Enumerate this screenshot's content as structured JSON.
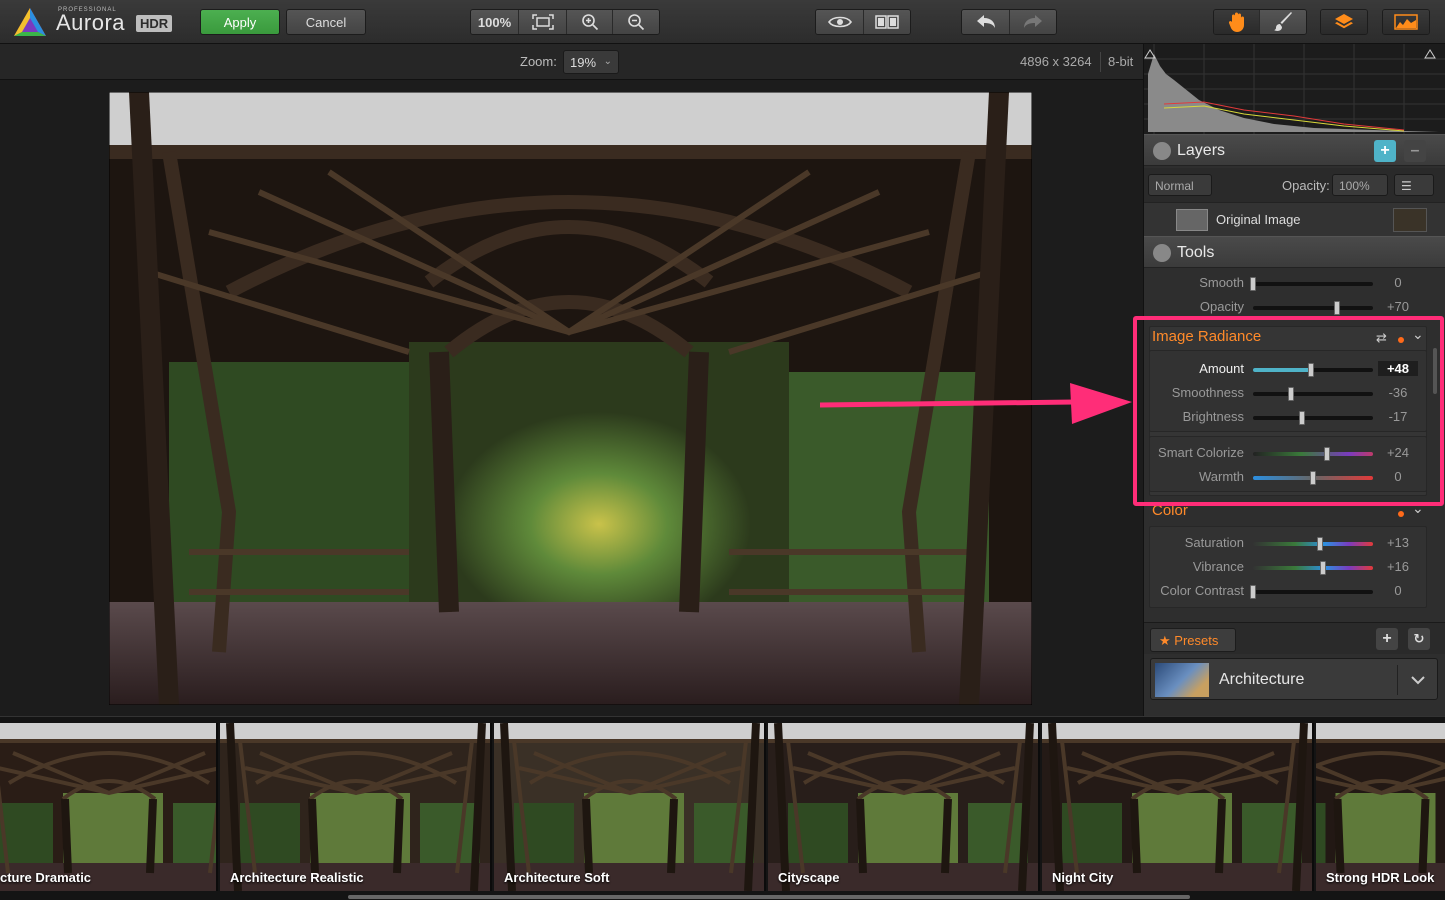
{
  "app": {
    "logo_name": "Aurora",
    "logo_pro": "PROFESSIONAL",
    "logo_badge": "HDR"
  },
  "toolbar": {
    "apply": "Apply",
    "cancel": "Cancel",
    "zoom_100": "100%"
  },
  "zoombar": {
    "label": "Zoom:",
    "value": "19%",
    "dimensions": "4896 x 3264",
    "bit_depth": "8-bit"
  },
  "layers": {
    "title": "Layers",
    "blend_mode": "Normal",
    "opacity_label": "Opacity:",
    "opacity_value": "100%",
    "layer_name": "Original Image"
  },
  "tools": {
    "title": "Tools",
    "top_sliders": [
      {
        "label": "Smooth",
        "value": "0",
        "pos": 0.0
      },
      {
        "label": "Opacity",
        "value": "+70",
        "pos": 0.7
      }
    ],
    "image_radiance": {
      "title": "Image Radiance",
      "sliders": [
        {
          "label": "Amount",
          "value": "+48",
          "pos": 0.48
        },
        {
          "label": "Smoothness",
          "value": "-36",
          "pos": 0.32
        },
        {
          "label": "Brightness",
          "value": "-17",
          "pos": 0.41
        }
      ],
      "sliders2": [
        {
          "label": "Smart Colorize",
          "value": "+24",
          "pos": 0.62
        },
        {
          "label": "Warmth",
          "value": "0",
          "pos": 0.5
        }
      ]
    },
    "color": {
      "title": "Color",
      "sliders": [
        {
          "label": "Saturation",
          "value": "+13",
          "pos": 0.56
        },
        {
          "label": "Vibrance",
          "value": "+16",
          "pos": 0.58
        },
        {
          "label": "Color Contrast",
          "value": "0",
          "pos": 0.0
        }
      ]
    }
  },
  "presets": {
    "tab_label": "Presets",
    "selected": "Architecture"
  },
  "filmstrip": {
    "items": [
      "cture Dramatic",
      "Architecture Realistic",
      "Architecture Soft",
      "Cityscape",
      "Night City",
      "Strong HDR Look"
    ]
  },
  "colors": {
    "accent_orange": "#ff8a2a",
    "apply_green": "#4caf50",
    "annotation_pink": "#ff2d78"
  }
}
